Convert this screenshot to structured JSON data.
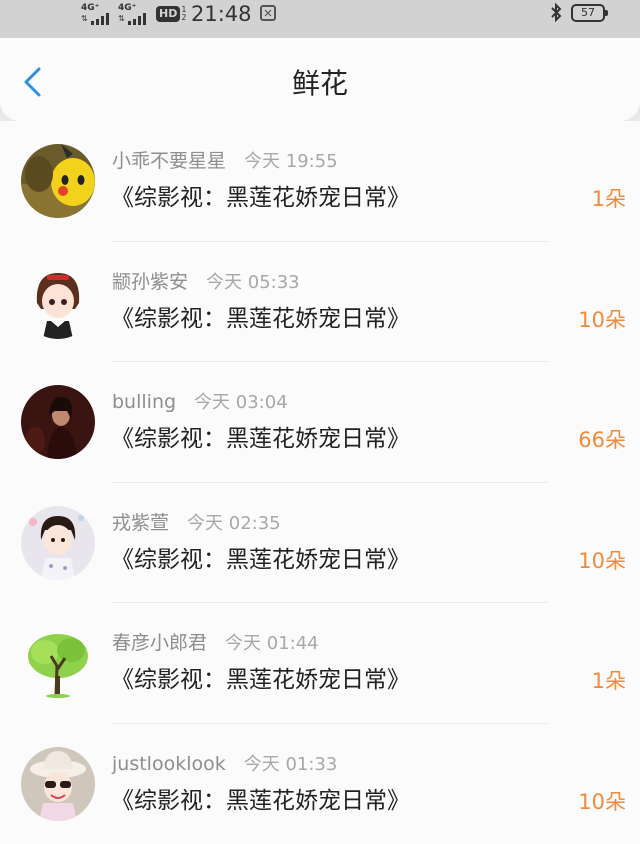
{
  "status_bar": {
    "net1": "4G⁺",
    "net2": "4G⁺",
    "hd": "HD",
    "hd_sub": "1\n2",
    "time": "21:48",
    "battery": "57"
  },
  "header": {
    "title": "鲜花"
  },
  "items": [
    {
      "name": "小乖不要星星",
      "time": "今天 19:55",
      "book": "《综影视：黑莲花娇宠日常》",
      "count": "1朵"
    },
    {
      "name": "颛孙紫安",
      "time": "今天 05:33",
      "book": "《综影视：黑莲花娇宠日常》",
      "count": "10朵"
    },
    {
      "name": "bulling",
      "time": "今天 03:04",
      "book": "《综影视：黑莲花娇宠日常》",
      "count": "66朵"
    },
    {
      "name": "戎紫萱",
      "time": "今天 02:35",
      "book": "《综影视：黑莲花娇宠日常》",
      "count": "10朵"
    },
    {
      "name": "春彦小郎君",
      "time": "今天 01:44",
      "book": "《综影视：黑莲花娇宠日常》",
      "count": "1朵"
    },
    {
      "name": "justlooklook",
      "time": "今天 01:33",
      "book": "《综影视：黑莲花娇宠日常》",
      "count": "10朵"
    }
  ]
}
